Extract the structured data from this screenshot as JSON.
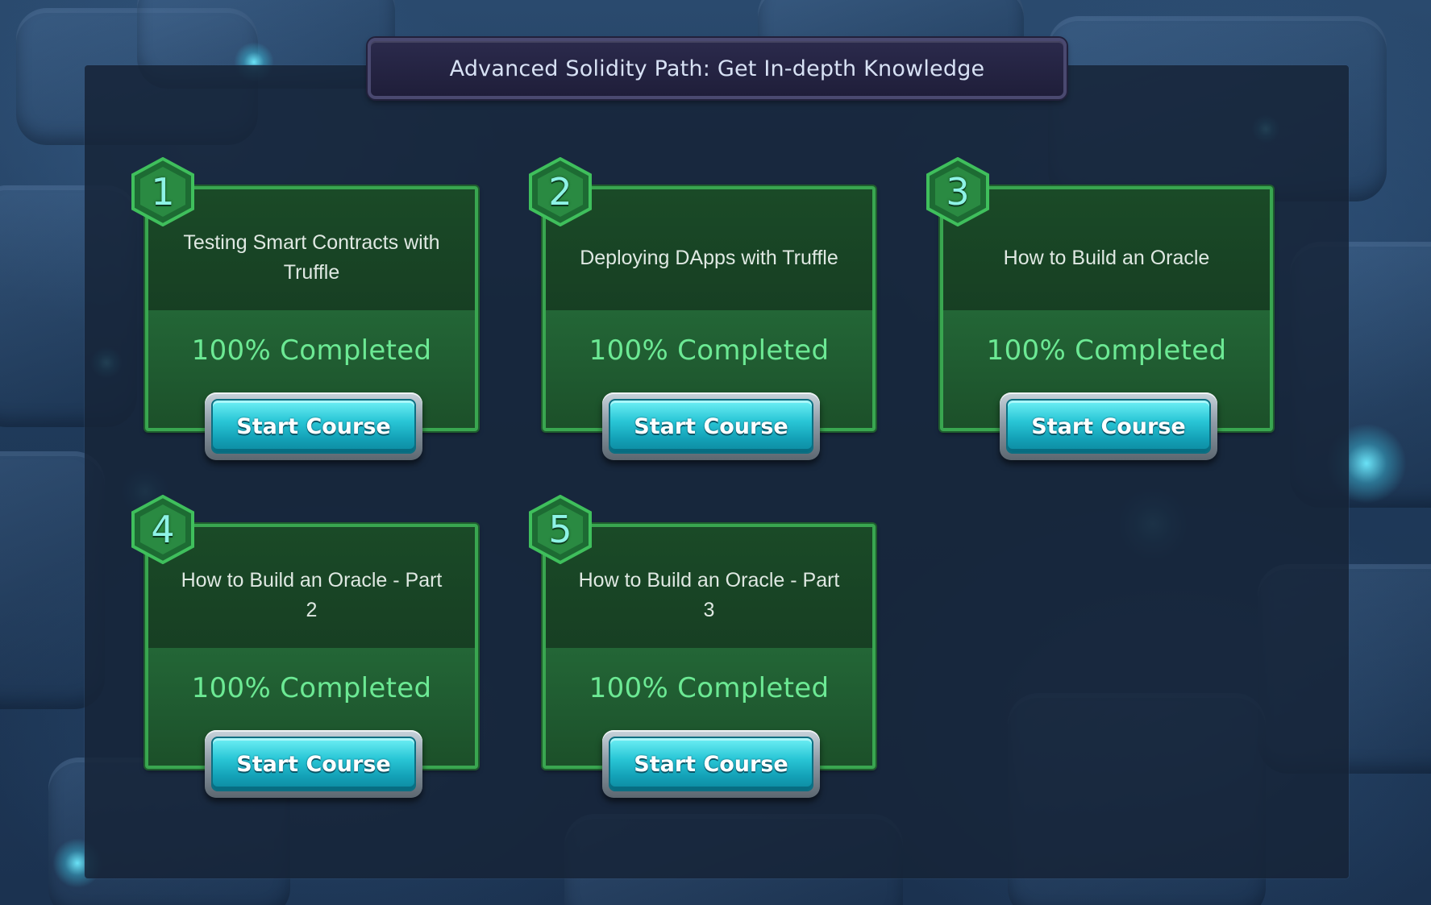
{
  "title": "Advanced Solidity Path: Get In-depth Knowledge",
  "colors": {
    "card_border": "#39a650",
    "progress_text": "#6ce994",
    "button_teal": "#29c6d6",
    "badge_green": "#2f9a48"
  },
  "courses": [
    {
      "number": "1",
      "title": "Testing Smart Contracts with Truffle",
      "progress": "100% Completed",
      "progress_value": 100,
      "button_label": "Start Course"
    },
    {
      "number": "2",
      "title": "Deploying DApps with Truffle",
      "progress": "100% Completed",
      "progress_value": 100,
      "button_label": "Start Course"
    },
    {
      "number": "3",
      "title": "How to Build an Oracle",
      "progress": "100% Completed",
      "progress_value": 100,
      "button_label": "Start Course"
    },
    {
      "number": "4",
      "title": "How to Build an Oracle - Part 2",
      "progress": "100% Completed",
      "progress_value": 100,
      "button_label": "Start Course"
    },
    {
      "number": "5",
      "title": "How to Build an Oracle - Part 3",
      "progress": "100% Completed",
      "progress_value": 100,
      "button_label": "Start Course"
    }
  ]
}
